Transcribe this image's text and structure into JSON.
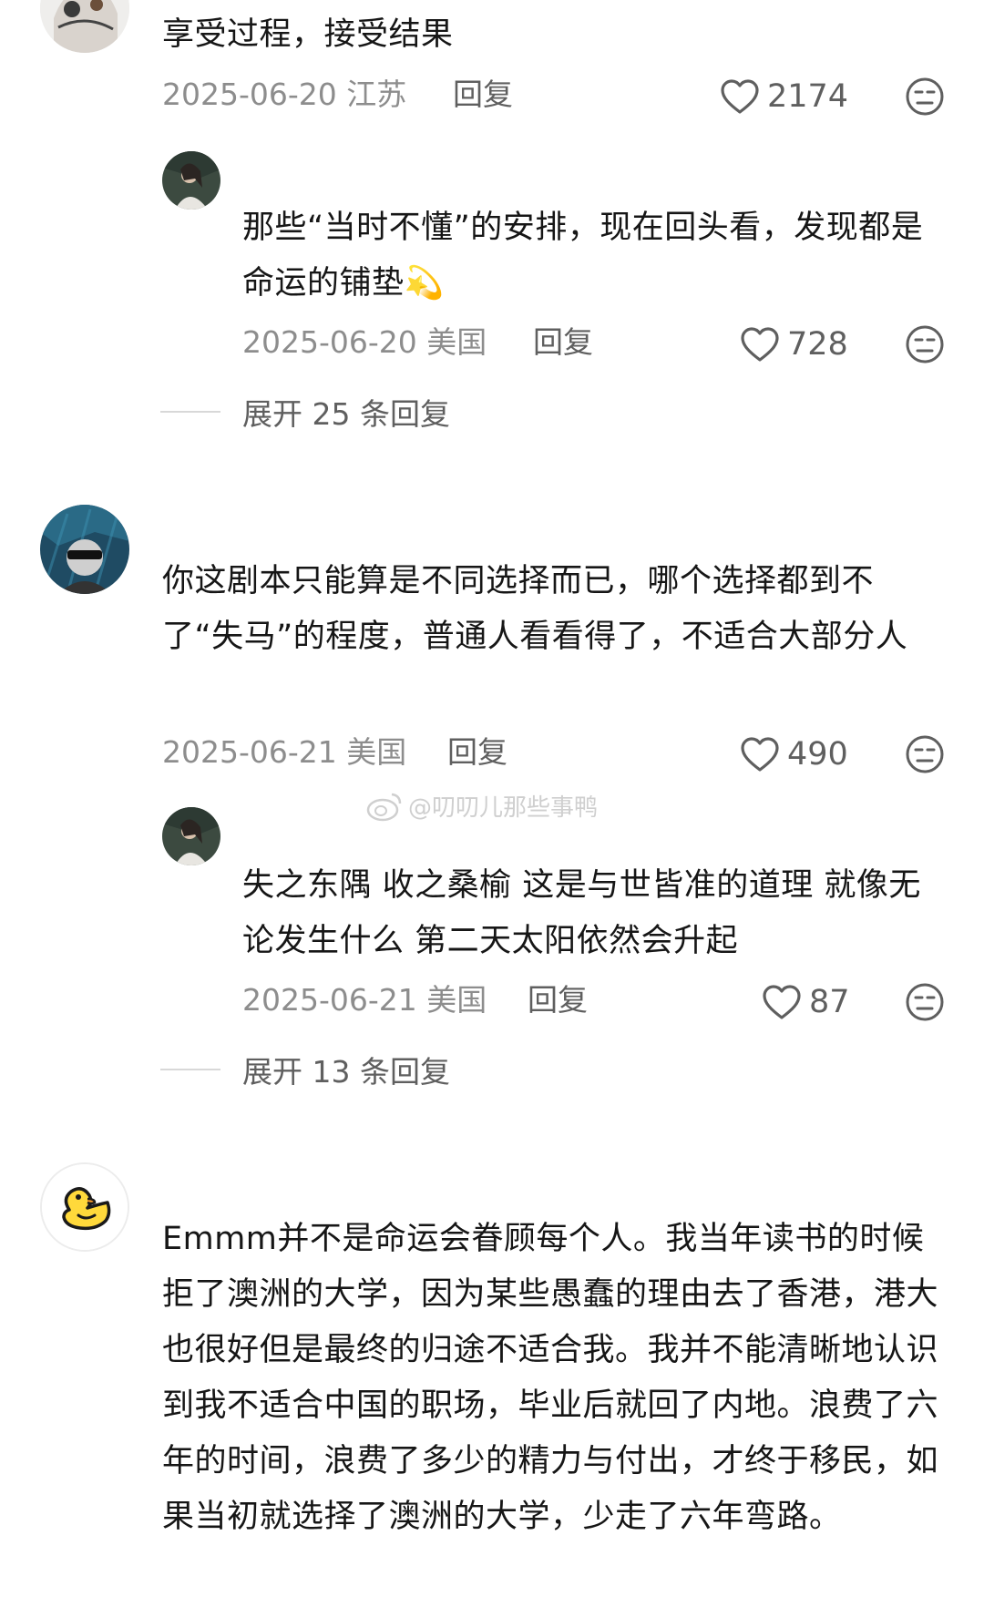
{
  "comments": [
    {
      "text": "享受过程，接受结果",
      "date": "2025-06-20",
      "location": "江苏",
      "reply_label": "回复",
      "likes": "2174"
    },
    {
      "text": "那些“当时不懂”的安排，现在回头看，发现都是命运的铺垫",
      "emoji": "💫",
      "date": "2025-06-20",
      "location": "美国",
      "reply_label": "回复",
      "likes": "728"
    },
    {
      "text": "你这剧本只能算是不同选择而已，哪个选择都到不了“失马”的程度，普通人看看得了，不适合大部分人",
      "date": "2025-06-21",
      "location": "美国",
      "reply_label": "回复",
      "likes": "490"
    },
    {
      "text": "失之东隅 收之桑榆 这是与世皆准的道理 就像无论发生什么 第二天太阳依然会升起",
      "date": "2025-06-21",
      "location": "美国",
      "reply_label": "回复",
      "likes": "87"
    },
    {
      "text": "Emmm并不是命运会眷顾每个人。我当年读书的时候拒了澳洲的大学，因为某些愚蠢的理由去了香港，港大也很好但是最终的归途不适合我。我并不能清晰地认识到我不适合中国的职场，毕业后就回了内地。浪费了六年的时间，浪费了多少的精力与付出，才终于移民，如果当初就选择了澳洲的大学，少走了六年弯路。"
    }
  ],
  "expand_replies": [
    "展开 25 条回复",
    "展开 13 条回复"
  ],
  "watermark": "@叨叨儿那些事鸭",
  "colors": {
    "text": "#161616",
    "meta": "#8d8d8d",
    "action": "#5f5f5f",
    "divider": "#d8d8d8"
  },
  "icons": [
    "heart-icon",
    "dislike-face-icon",
    "weibo-logo-icon"
  ]
}
